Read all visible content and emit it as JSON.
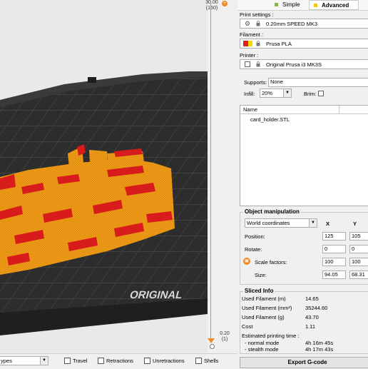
{
  "slider": {
    "top_value": "30.00",
    "top_layer": "(150)",
    "bottom_value": "0.20",
    "bottom_layer": "(1)"
  },
  "viewport": {
    "bed_logo": "ORIGINAL"
  },
  "bottom_bar": {
    "view_select": "ypes",
    "options": [
      "Travel",
      "Retractions",
      "Unretractions",
      "Shells"
    ]
  },
  "mode_tabs": [
    {
      "label": "Simple",
      "color": "#7cbf3a",
      "active": false
    },
    {
      "label": "Advanced",
      "color": "#f5c518",
      "active": true
    }
  ],
  "print_settings": {
    "label": "Print settings :",
    "value": "0.20mm SPEED MK3"
  },
  "filament": {
    "label": "Filament :",
    "value": "Prusa PLA",
    "swatch_colors": [
      "#e02020",
      "#f5d800"
    ]
  },
  "printer": {
    "label": "Printer :",
    "value": "Original Prusa i3 MK3S"
  },
  "supports": {
    "label": "Supports:",
    "value": "None"
  },
  "infill": {
    "label": "Infill:",
    "value": "20%"
  },
  "brim": {
    "label": "Brim:",
    "checked": false
  },
  "object_list": {
    "column_name": "Name",
    "items": [
      "card_holder.STL"
    ]
  },
  "object_manipulation": {
    "title": "Object manipulation",
    "coord_system": "World coordinates",
    "col_x": "X",
    "col_y": "Y",
    "position": {
      "label": "Position:",
      "x": "125",
      "y": "105"
    },
    "rotate": {
      "label": "Rotate:",
      "x": "0",
      "y": "0"
    },
    "scale": {
      "label": "Scale factors:",
      "x": "100",
      "y": "100"
    },
    "size": {
      "label": "Size:",
      "x": "94.05",
      "y": "68.31"
    }
  },
  "sliced_info": {
    "title": "Sliced Info",
    "rows": [
      {
        "label": "Used Filament (m)",
        "value": "14.65"
      },
      {
        "label": "Used Filament (mm³)",
        "value": "35244.60"
      },
      {
        "label": "Used Filament (g)",
        "value": "43.70"
      },
      {
        "label": "Cost",
        "value": "1.11"
      }
    ],
    "time_label": "Estimated printing time :",
    "normal": {
      "label": "- normal mode",
      "value": "4h 16m 45s"
    },
    "stealth": {
      "label": "- stealth mode",
      "value": "4h 17m 43s"
    }
  },
  "export_button": "Export G-code",
  "colors": {
    "accent": "#f08a24",
    "model_orange": "#f2a01a",
    "model_red": "#d81c1c",
    "bed": "#2b2b2b"
  }
}
